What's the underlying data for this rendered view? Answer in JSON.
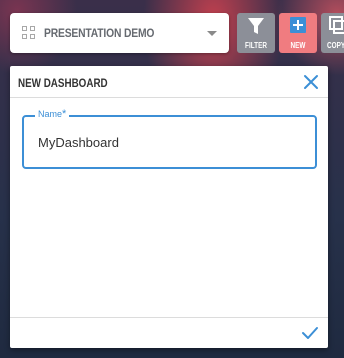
{
  "colors": {
    "accent": "#3c8fd6",
    "new_button": "#f07c80",
    "tool_button": "#8c8f98"
  },
  "toolbar": {
    "dashboard_select": {
      "selected": "PRESENTATION DEMO",
      "icon": "grid-icon"
    },
    "filter": {
      "label": "FILTER",
      "icon": "filter-icon"
    },
    "new": {
      "label": "NEW",
      "icon": "plus-icon"
    },
    "copy": {
      "label": "COPY",
      "icon": "copy-icon"
    }
  },
  "dialog": {
    "title": "NEW DASHBOARD",
    "close_icon": "close-icon",
    "name_field": {
      "label": "Name",
      "required_mark": "*",
      "value": "MyDashboard"
    },
    "confirm_icon": "check-icon"
  }
}
